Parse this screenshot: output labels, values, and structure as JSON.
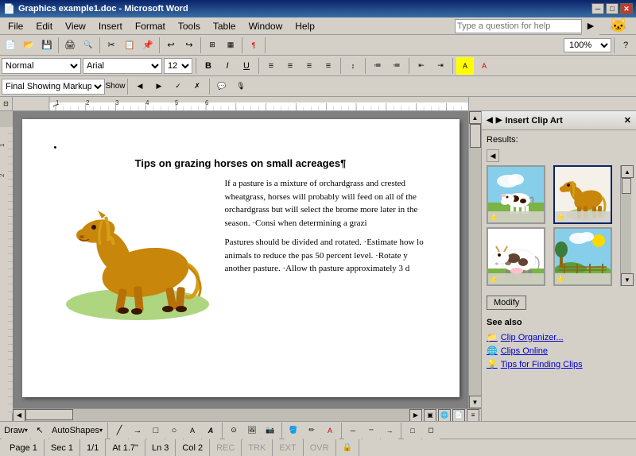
{
  "titlebar": {
    "title": "Graphics example1.doc - Microsoft Word",
    "icon": "word-icon",
    "minimize": "─",
    "restore": "□",
    "close": "✕"
  },
  "menubar": {
    "items": [
      {
        "label": "File",
        "id": "menu-file"
      },
      {
        "label": "Edit",
        "id": "menu-edit"
      },
      {
        "label": "View",
        "id": "menu-view"
      },
      {
        "label": "Insert",
        "id": "menu-insert"
      },
      {
        "label": "Format",
        "id": "menu-format"
      },
      {
        "label": "Tools",
        "id": "menu-tools"
      },
      {
        "label": "Table",
        "id": "menu-table"
      },
      {
        "label": "Window",
        "id": "menu-window"
      },
      {
        "label": "Help",
        "id": "menu-help"
      }
    ],
    "search_placeholder": "Type a question for help"
  },
  "toolbar": {
    "zoom": "100%"
  },
  "toolbar2": {
    "style": "Normal",
    "font": "Arial",
    "size": "12",
    "bold": "B",
    "italic": "I",
    "underline": "U"
  },
  "toolbar3": {
    "review_mode": "Final Showing Markup",
    "show_label": "Show"
  },
  "document": {
    "title": "Tips on grazing horses on small acreages¶",
    "bullet": "•",
    "body_para1": "If a pasture is a mixture of orchardgrass and crested wheatgrass, horses will probably will feed on all of the orchardgrass but will select the brome more later in the season. Consid when determining a grazi",
    "body_para2": "Pastures should be divided and rotated. Estimate how lo animals to reduce the pas 50 percent level. Rotate y another pasture. Allow th pasture approximately 3 d"
  },
  "clipart_panel": {
    "title": "Insert Clip Art",
    "results_label": "Results:",
    "modify_btn": "Modify",
    "see_also_title": "See also",
    "see_also_items": [
      {
        "label": "Clip Organizer...",
        "icon": "organizer-icon"
      },
      {
        "label": "Clips Online",
        "icon": "online-icon"
      },
      {
        "label": "Tips for Finding Clips",
        "icon": "tips-icon"
      }
    ]
  },
  "statusbar": {
    "page": "Page 1",
    "sec": "Sec 1",
    "pages": "1/1",
    "at": "At 1.7\"",
    "ln": "Ln 3",
    "col": "Col 2",
    "rec": "REC",
    "trk": "TRK",
    "ext": "EXT",
    "ovr": "OVR"
  },
  "drawtoolbar": {
    "draw_label": "Draw",
    "autoshapes_label": "AutoShapes"
  }
}
